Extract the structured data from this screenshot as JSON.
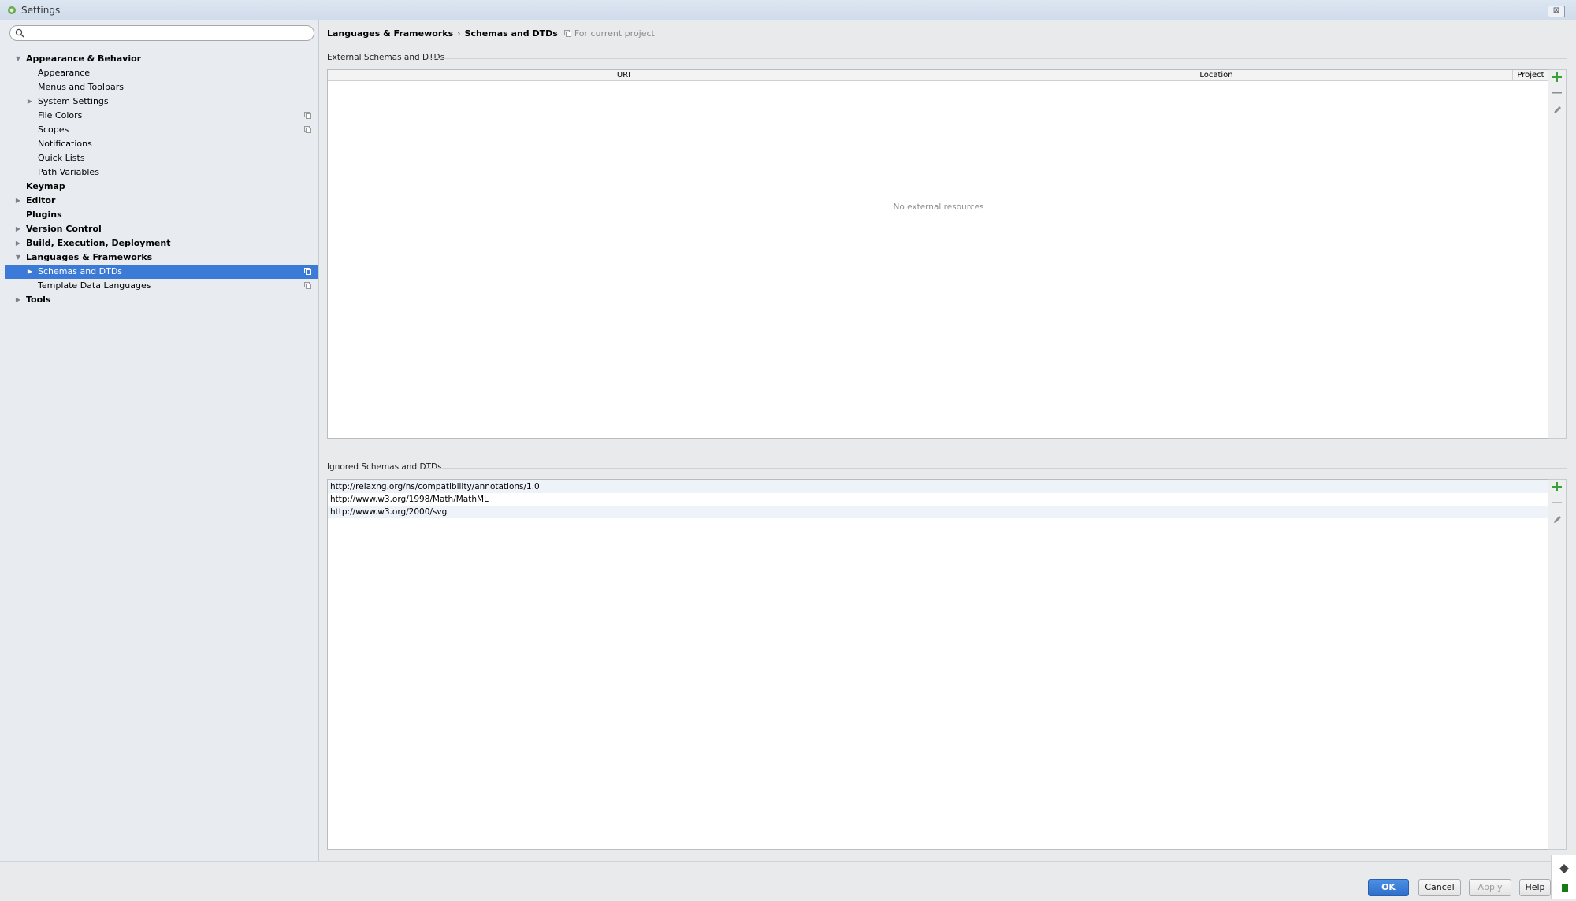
{
  "window": {
    "title": "Settings",
    "close_glyph": "⊠"
  },
  "search": {
    "placeholder": ""
  },
  "sidebar": {
    "items": [
      {
        "label": "Appearance & Behavior",
        "bold": true,
        "arrow": "down"
      },
      {
        "label": "Appearance"
      },
      {
        "label": "Menus and Toolbars"
      },
      {
        "label": "System Settings",
        "arrow": "right"
      },
      {
        "label": "File Colors",
        "copy": true
      },
      {
        "label": "Scopes",
        "copy": true
      },
      {
        "label": "Notifications"
      },
      {
        "label": "Quick Lists"
      },
      {
        "label": "Path Variables"
      },
      {
        "label": "Keymap",
        "bold": true
      },
      {
        "label": "Editor",
        "bold": true,
        "arrow": "right"
      },
      {
        "label": "Plugins",
        "bold": true
      },
      {
        "label": "Version Control",
        "bold": true,
        "arrow": "right"
      },
      {
        "label": "Build, Execution, Deployment",
        "bold": true,
        "arrow": "right"
      },
      {
        "label": "Languages & Frameworks",
        "bold": true,
        "arrow": "down"
      },
      {
        "label": "Schemas and DTDs",
        "arrow": "right",
        "copy": true,
        "selected": true
      },
      {
        "label": "Template Data Languages",
        "copy": true
      },
      {
        "label": "Tools",
        "bold": true,
        "arrow": "right"
      }
    ]
  },
  "breadcrumb": {
    "parent": "Languages & Frameworks",
    "separator": "›",
    "current": "Schemas and DTDs",
    "scope": "For current project"
  },
  "external": {
    "title": "External Schemas and DTDs",
    "columns": [
      "URI",
      "Location",
      "Project"
    ],
    "empty_text": "No external resources"
  },
  "ignored": {
    "title": "Ignored Schemas and DTDs",
    "rows": [
      "http://relaxng.org/ns/compatibility/annotations/1.0",
      "http://www.w3.org/1998/Math/MathML",
      "http://www.w3.org/2000/svg"
    ]
  },
  "tools": {
    "add": "+",
    "remove": "—"
  },
  "buttons": {
    "ok": "OK",
    "cancel": "Cancel",
    "apply": "Apply",
    "help": "Help"
  },
  "colors": {
    "selection": "#3b7ad6",
    "add_green": "#3aa13a",
    "ok_blue": "#2f6fcc"
  }
}
